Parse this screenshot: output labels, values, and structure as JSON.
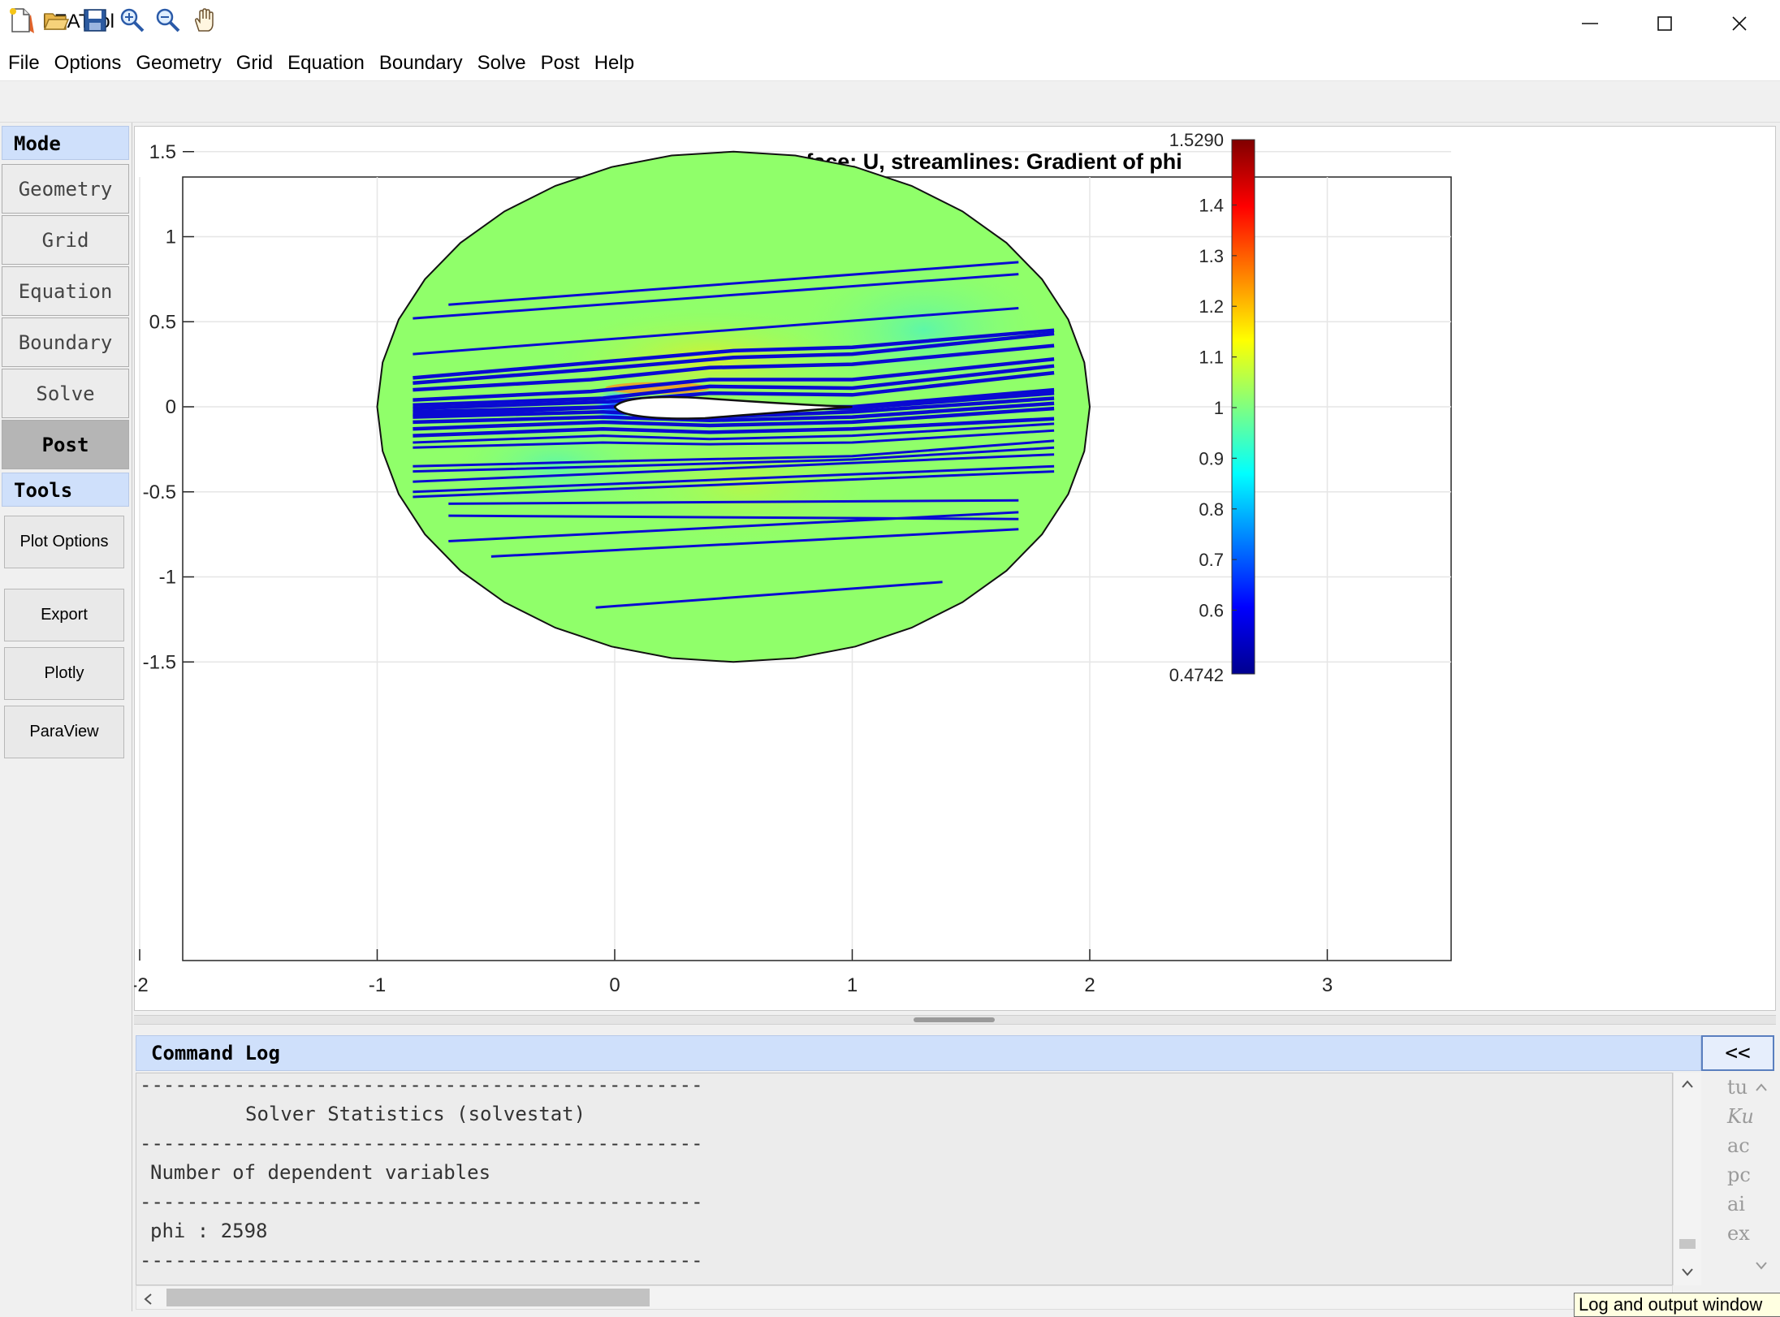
{
  "window": {
    "title": "FEATool",
    "controls": [
      "minimize-icon",
      "maximize-icon",
      "close-icon"
    ]
  },
  "menu": [
    "File",
    "Options",
    "Geometry",
    "Grid",
    "Equation",
    "Boundary",
    "Solve",
    "Post",
    "Help"
  ],
  "toolbar": {
    "icons": [
      "new-file-icon",
      "open-folder-icon",
      "save-icon",
      "zoom-in-icon",
      "zoom-out-icon",
      "pan-hand-icon"
    ]
  },
  "sidebar": {
    "mode_header": "Mode",
    "modes": [
      {
        "label": "Geometry",
        "active": false
      },
      {
        "label": "Grid",
        "active": false
      },
      {
        "label": "Equation",
        "active": false
      },
      {
        "label": "Boundary",
        "active": false
      },
      {
        "label": "Solve",
        "active": false
      },
      {
        "label": "Post",
        "active": true
      }
    ],
    "tools_header": "Tools",
    "tools": [
      "Plot Options",
      "Export",
      "Plotly",
      "ParaView"
    ]
  },
  "chart_data": {
    "type": "heatmap",
    "title": "surface: U, streamlines: Gradient of phi",
    "xlabel": "",
    "ylabel": "",
    "xlim": [
      -2.85,
      3.85
    ],
    "ylim": [
      -1.65,
      1.65
    ],
    "xticks": [
      -2,
      -1,
      0,
      1,
      2,
      3
    ],
    "yticks": [
      -1.5,
      -1,
      -0.5,
      0,
      0.5,
      1,
      1.5
    ],
    "domain": {
      "shape": "circle",
      "center": [
        0.5,
        0
      ],
      "radius": 1.5
    },
    "airfoil": {
      "leading_edge": [
        0,
        0
      ],
      "trailing_edge": [
        1,
        0
      ]
    },
    "colormap": "jet",
    "colorbar": {
      "min": 0.4742,
      "max": 1.529,
      "min_label": "0.4742",
      "max_label": "1.5290",
      "ticks": [
        0.6,
        0.7,
        0.8,
        0.9,
        1,
        1.1,
        1.2,
        1.3,
        1.4
      ]
    },
    "streamline_color": "#0a0ad2",
    "domain_fill": "#90ff6a",
    "streamlines": [
      [
        [
          -0.7,
          0.6
        ],
        [
          1.7,
          0.85
        ]
      ],
      [
        [
          -0.85,
          0.52
        ],
        [
          1.7,
          0.78
        ]
      ],
      [
        [
          -0.85,
          0.31
        ],
        [
          1.7,
          0.58
        ]
      ],
      [
        [
          -0.85,
          0.17
        ],
        [
          0.0,
          0.27
        ],
        [
          0.5,
          0.33
        ],
        [
          1.0,
          0.35
        ],
        [
          1.85,
          0.45
        ]
      ],
      [
        [
          -0.85,
          0.14
        ],
        [
          0.0,
          0.23
        ],
        [
          0.5,
          0.29
        ],
        [
          1.0,
          0.31
        ],
        [
          1.85,
          0.43
        ]
      ],
      [
        [
          -0.85,
          0.1
        ],
        [
          -0.1,
          0.16
        ],
        [
          0.4,
          0.23
        ],
        [
          1.0,
          0.25
        ],
        [
          1.85,
          0.36
        ]
      ],
      [
        [
          -0.85,
          0.04
        ],
        [
          -0.1,
          0.09
        ],
        [
          0.4,
          0.16
        ],
        [
          1.0,
          0.16
        ],
        [
          1.85,
          0.28
        ]
      ],
      [
        [
          -0.85,
          0.01
        ],
        [
          -0.05,
          0.05
        ],
        [
          0.4,
          0.12
        ],
        [
          1.0,
          0.11
        ],
        [
          1.85,
          0.24
        ]
      ],
      [
        [
          -0.85,
          -0.01
        ],
        [
          -0.03,
          0.03
        ],
        [
          0.4,
          0.08
        ],
        [
          1.0,
          0.07
        ],
        [
          1.85,
          0.2
        ]
      ],
      [
        [
          -0.85,
          -0.03
        ],
        [
          0.0,
          0.0
        ],
        [
          1.0,
          0.0
        ],
        [
          1.85,
          0.1
        ]
      ],
      [
        [
          -0.85,
          -0.05
        ],
        [
          0.0,
          0.0
        ],
        [
          1.0,
          -0.01
        ],
        [
          1.85,
          0.08
        ]
      ],
      [
        [
          -0.85,
          -0.06
        ],
        [
          -0.05,
          -0.03
        ],
        [
          0.4,
          -0.06
        ],
        [
          1.0,
          -0.03
        ],
        [
          1.85,
          0.05
        ]
      ],
      [
        [
          -0.85,
          -0.09
        ],
        [
          -0.05,
          -0.06
        ],
        [
          0.4,
          -0.08
        ],
        [
          1.0,
          -0.06
        ],
        [
          1.85,
          0.02
        ]
      ],
      [
        [
          -0.85,
          -0.13
        ],
        [
          -0.05,
          -0.09
        ],
        [
          0.4,
          -0.11
        ],
        [
          1.0,
          -0.09
        ],
        [
          1.85,
          -0.01
        ]
      ],
      [
        [
          -0.85,
          -0.17
        ],
        [
          -0.05,
          -0.13
        ],
        [
          0.4,
          -0.15
        ],
        [
          1.0,
          -0.13
        ],
        [
          1.85,
          -0.07
        ]
      ],
      [
        [
          -0.85,
          -0.21
        ],
        [
          -0.05,
          -0.17
        ],
        [
          0.4,
          -0.19
        ],
        [
          1.0,
          -0.17
        ],
        [
          1.85,
          -0.1
        ]
      ],
      [
        [
          -0.85,
          -0.24
        ],
        [
          -0.05,
          -0.21
        ],
        [
          0.4,
          -0.22
        ],
        [
          1.0,
          -0.21
        ],
        [
          1.85,
          -0.14
        ]
      ],
      [
        [
          -0.85,
          -0.35
        ],
        [
          0.0,
          -0.32
        ],
        [
          1.0,
          -0.29
        ],
        [
          1.85,
          -0.2
        ]
      ],
      [
        [
          -0.85,
          -0.38
        ],
        [
          0.0,
          -0.35
        ],
        [
          1.0,
          -0.31
        ],
        [
          1.85,
          -0.24
        ]
      ],
      [
        [
          -0.85,
          -0.44
        ],
        [
          1.85,
          -0.28
        ]
      ],
      [
        [
          -0.85,
          -0.5
        ],
        [
          1.85,
          -0.35
        ]
      ],
      [
        [
          -0.85,
          -0.53
        ],
        [
          1.85,
          -0.38
        ]
      ],
      [
        [
          -0.7,
          -0.57
        ],
        [
          1.7,
          -0.55
        ]
      ],
      [
        [
          -0.7,
          -0.64
        ],
        [
          1.7,
          -0.66
        ]
      ],
      [
        [
          -0.7,
          -0.79
        ],
        [
          1.7,
          -0.62
        ]
      ],
      [
        [
          -0.52,
          -0.88
        ],
        [
          1.7,
          -0.72
        ]
      ],
      [
        [
          -0.08,
          -1.18
        ],
        [
          1.38,
          -1.03
        ]
      ]
    ]
  },
  "command_log": {
    "title": "Command Log",
    "toggle_label": "<<",
    "lines": [
      "------------------------------------------------",
      "         Solver Statistics (solvestat)",
      "------------------------------------------------",
      "Number of dependent variables",
      "------------------------------------------------",
      "phi : 2598",
      "------------------------------------------------"
    ]
  },
  "help_panel": {
    "words": [
      "tu",
      "Ku",
      "ac",
      "pc",
      "ai",
      "ex"
    ]
  },
  "tooltip": "Log and output window"
}
